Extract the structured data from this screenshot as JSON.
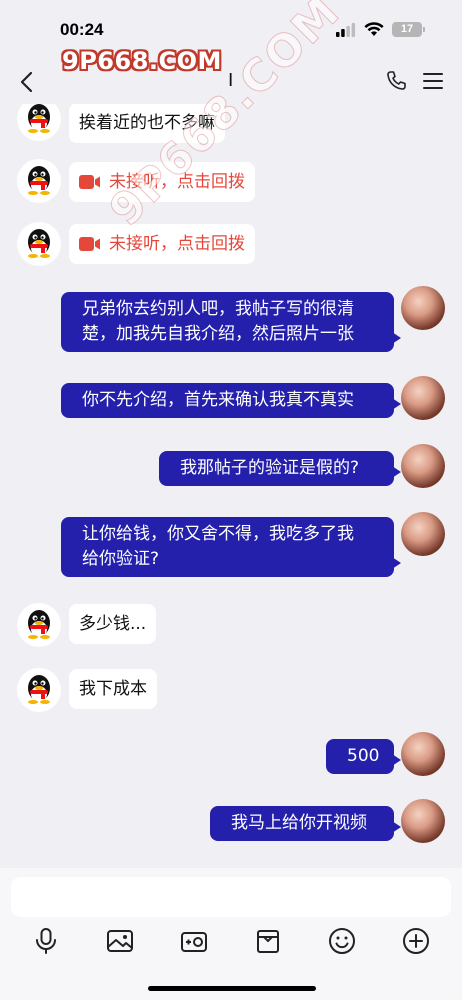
{
  "status_bar": {
    "time": "00:24",
    "battery": "17",
    "icons": [
      "signal-icon",
      "wifi-icon",
      "battery-icon"
    ]
  },
  "watermark": {
    "logo": "9P668.COM",
    "diagonal": "9P668.COM"
  },
  "nav": {
    "title": "I",
    "back_icon": "chevron-left-icon",
    "call_icon": "phone-icon",
    "menu_icon": "menu-icon"
  },
  "messages": [
    {
      "side": "left",
      "text": "挨着近的也不多嘛"
    },
    {
      "side": "left",
      "type": "missed-video",
      "text": "未接听，点击回拨"
    },
    {
      "side": "left",
      "type": "missed-video",
      "text": "未接听，点击回拨"
    },
    {
      "side": "right",
      "lines": [
        "兄弟你去约别人吧，我帖子写的很清",
        "楚，加我先自我介绍，然后照片一张"
      ]
    },
    {
      "side": "right",
      "lines": [
        "你不先介绍，首先来确认我真不真实"
      ]
    },
    {
      "side": "right",
      "lines": [
        "我那帖子的验证是假的?"
      ]
    },
    {
      "side": "right",
      "lines": [
        "让你给钱，你又舍不得，我吃多了我",
        "给你验证?"
      ]
    },
    {
      "side": "left",
      "text": "多少钱..."
    },
    {
      "side": "left",
      "text": "我下成本"
    },
    {
      "side": "right",
      "lines": [
        "500"
      ]
    },
    {
      "side": "right",
      "lines": [
        "我马上给你开视频"
      ]
    }
  ],
  "composer": {
    "input_value": "",
    "tools": [
      "microphone-icon",
      "image-icon",
      "camera-icon",
      "gift-box-icon",
      "emoji-icon",
      "plus-icon"
    ]
  },
  "colors": {
    "background": "#f0eff4",
    "sent_bubble": "#2420ac",
    "received_bubble": "#ffffff",
    "missed_call": "#e5483b"
  }
}
